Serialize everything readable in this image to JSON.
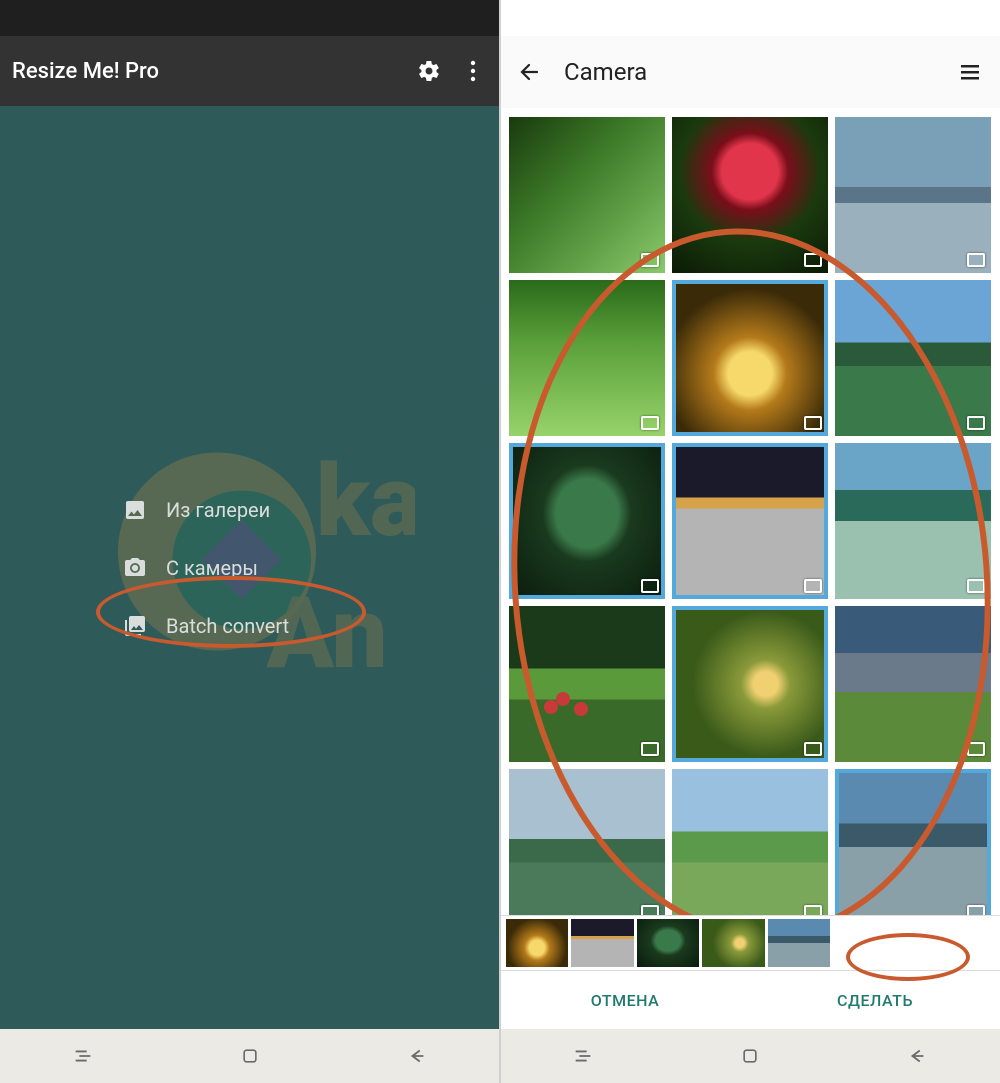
{
  "left": {
    "app_title": "Resize Me! Pro",
    "menu": {
      "gallery_label": "Из галереи",
      "camera_label": "С камеры",
      "batch_label": "Batch convert"
    }
  },
  "right": {
    "header_title": "Camera",
    "actions": {
      "cancel": "ОТМЕНА",
      "done": "СДЕЛАТЬ"
    },
    "thumbs": [
      {
        "id": "g1",
        "selected": false
      },
      {
        "id": "g2",
        "selected": false
      },
      {
        "id": "g3",
        "selected": false
      },
      {
        "id": "g4",
        "selected": false
      },
      {
        "id": "g5",
        "selected": true
      },
      {
        "id": "g6",
        "selected": false
      },
      {
        "id": "g7",
        "selected": true
      },
      {
        "id": "g8",
        "selected": true
      },
      {
        "id": "g9",
        "selected": false
      },
      {
        "id": "g10",
        "selected": false
      },
      {
        "id": "g11",
        "selected": true
      },
      {
        "id": "g12",
        "selected": false
      },
      {
        "id": "g13",
        "selected": false
      },
      {
        "id": "g14",
        "selected": false
      },
      {
        "id": "g15",
        "selected": true
      }
    ],
    "partial": [
      {
        "id": "g16"
      },
      {
        "id": "g17"
      },
      {
        "id": "g18"
      }
    ],
    "strip": [
      {
        "id": "g5"
      },
      {
        "id": "g8"
      },
      {
        "id": "g7"
      },
      {
        "id": "g11"
      },
      {
        "id": "g15"
      }
    ]
  }
}
